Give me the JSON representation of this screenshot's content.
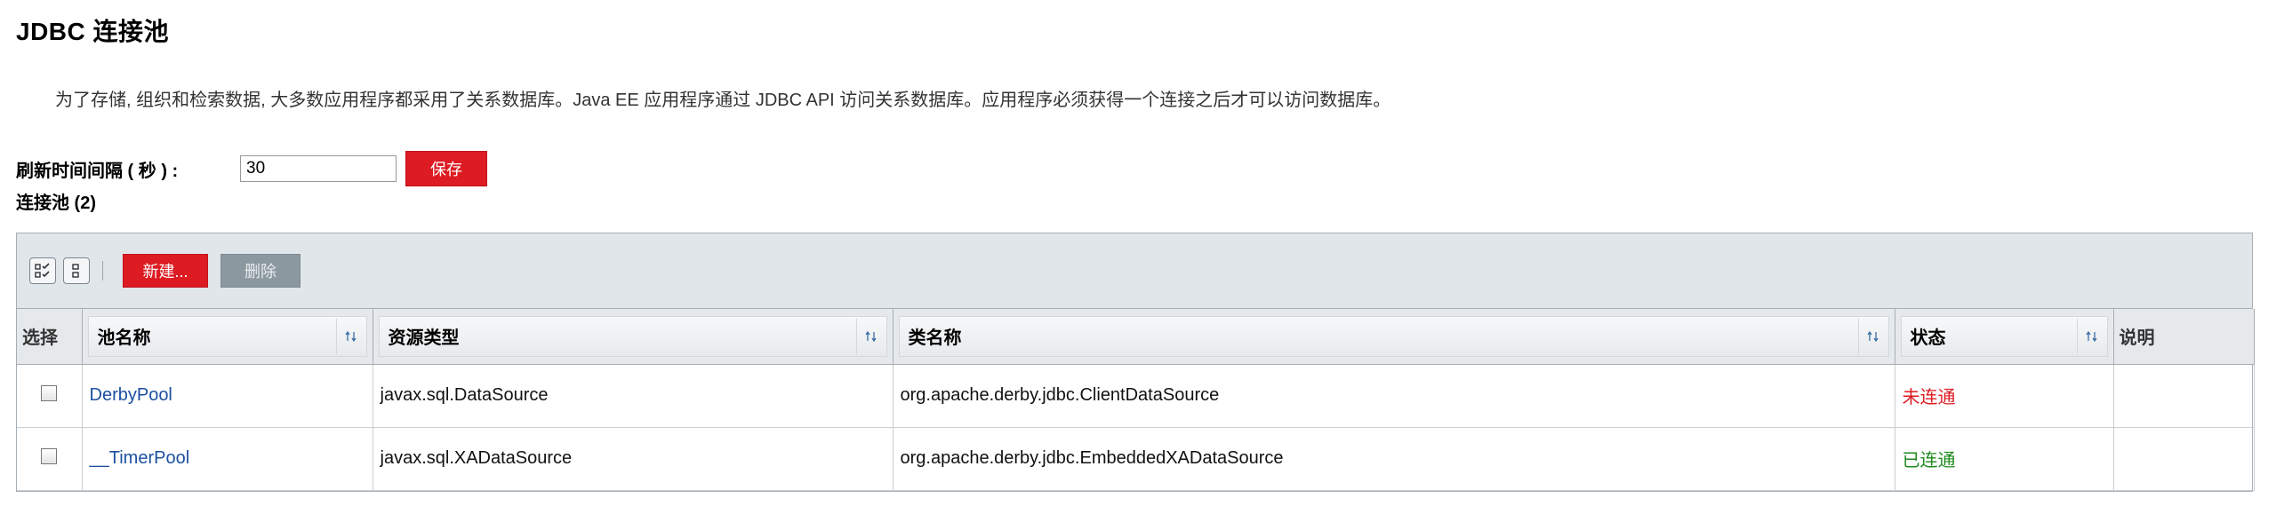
{
  "page": {
    "title": "JDBC 连接池",
    "description": "为了存储, 组织和检索数据, 大多数应用程序都采用了关系数据库。Java EE 应用程序通过 JDBC API 访问关系数据库。应用程序必须获得一个连接之后才可以访问数据库。"
  },
  "refresh": {
    "label": "刷新时间间隔 ( 秒 ) :",
    "value": "30",
    "save_label": "保存"
  },
  "pools": {
    "count_label": "连接池 (2)",
    "toolbar": {
      "select_all_icon": "select-all-icon",
      "deselect_all_icon": "deselect-all-icon",
      "new_label": "新建...",
      "delete_label": "删除"
    },
    "columns": {
      "select": "选择",
      "pool_name": "池名称",
      "resource_type": "资源类型",
      "class_name": "类名称",
      "status": "状态",
      "description": "说明"
    },
    "rows": [
      {
        "pool_name": "DerbyPool",
        "resource_type": "javax.sql.DataSource",
        "class_name": "org.apache.derby.jdbc.ClientDataSource",
        "status": "未连通",
        "status_color": "#dd1b22",
        "description": ""
      },
      {
        "pool_name": "__TimerPool",
        "resource_type": "javax.sql.XADataSource",
        "class_name": "org.apache.derby.jdbc.EmbeddedXADataSource",
        "status": "已连通",
        "status_color": "#1e8a1e",
        "description": ""
      }
    ]
  },
  "colors": {
    "accent_red": "#dd1b22",
    "link_blue": "#1c4f9f",
    "toolbar_bg": "#e1e6eb"
  }
}
